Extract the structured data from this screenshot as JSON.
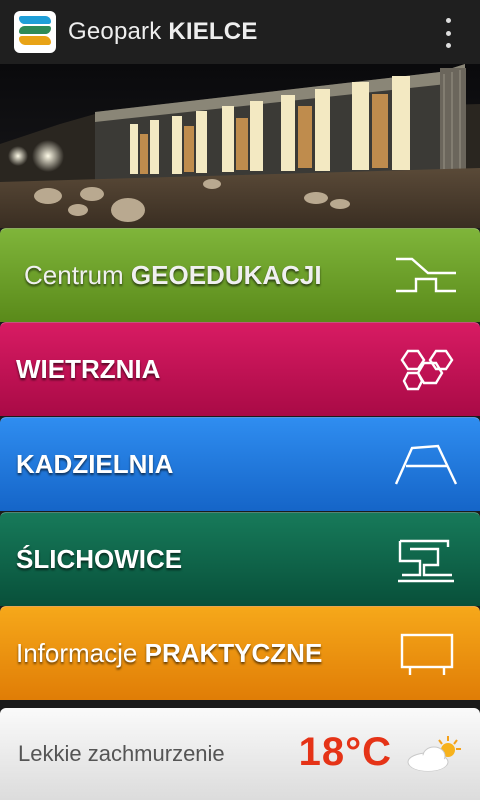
{
  "app": {
    "title_light": "Geopark ",
    "title_bold": "KIELCE"
  },
  "menu": [
    {
      "label_light": "Centrum ",
      "label_bold": "GEOEDUKACJI",
      "icon": "terrain-step-icon",
      "color": "#6ea22a"
    },
    {
      "label_light": "",
      "label_bold": "WIETRZNIA",
      "icon": "crystals-icon",
      "color": "#c3114f"
    },
    {
      "label_light": "",
      "label_bold": "KADZIELNIA",
      "icon": "quarry-icon",
      "color": "#1f7ce0"
    },
    {
      "label_light": "",
      "label_bold": "ŚLICHOWICE",
      "icon": "rock-fold-icon",
      "color": "#0f6547"
    },
    {
      "label_light": "Informacje ",
      "label_bold": "PRAKTYCZNE",
      "icon": "info-board-icon",
      "color": "#f0900c"
    }
  ],
  "weather": {
    "condition": "Lekkie zachmurzenie",
    "temperature": "18°C",
    "icon": "partly-cloudy-icon"
  }
}
